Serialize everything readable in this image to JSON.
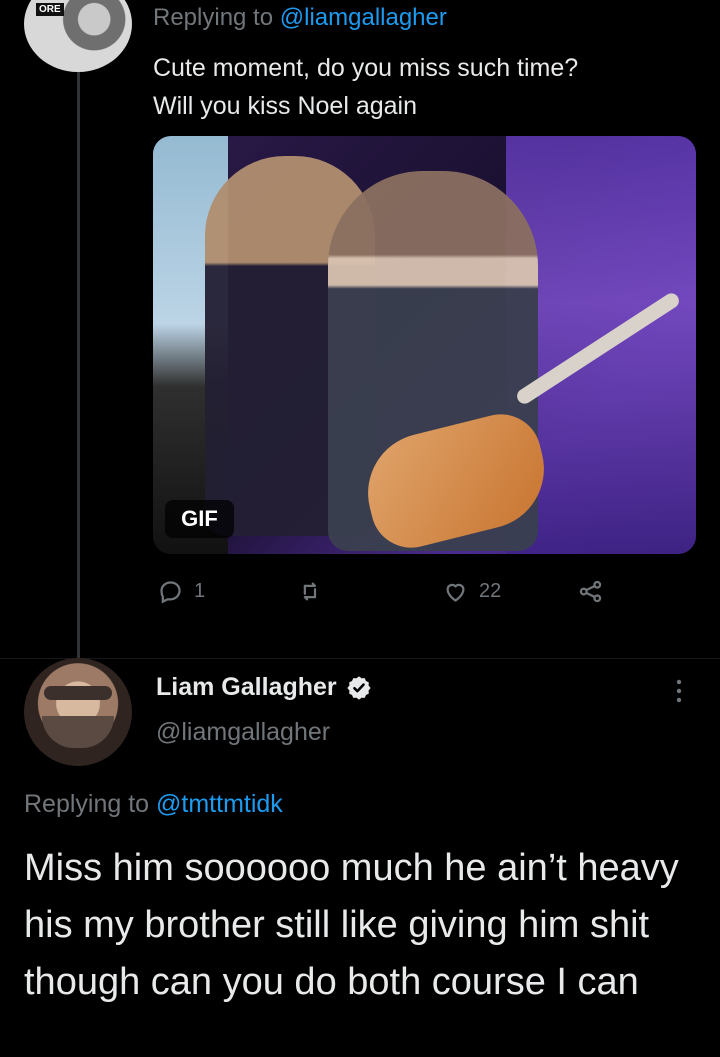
{
  "thread": {
    "reply_prefix": "Replying to ",
    "reply_mention": "@liamgallagher",
    "text": "Cute moment, do you miss such time?\nWill you kiss Noel again",
    "media": {
      "badge": "GIF"
    },
    "actions": {
      "reply_count": "1",
      "like_count": "22"
    }
  },
  "reply": {
    "name": "Liam Gallagher",
    "handle": "@liamgallagher",
    "reply_prefix": "Replying to ",
    "reply_mention": "@tmttmtidk",
    "text": "Miss him soooooo much he ain’t heavy his my brother still like giving him shit though can you do both course I can"
  },
  "colors": {
    "background": "#000000",
    "text": "#e7e9ea",
    "muted": "#71767b",
    "link": "#1d9bf0",
    "verified": "#1d9bf0"
  },
  "icons": {
    "reply": "reply-icon",
    "retweet": "retweet-icon",
    "like": "like-icon",
    "share": "share-icon",
    "more": "more-icon",
    "verified": "verified-icon"
  }
}
